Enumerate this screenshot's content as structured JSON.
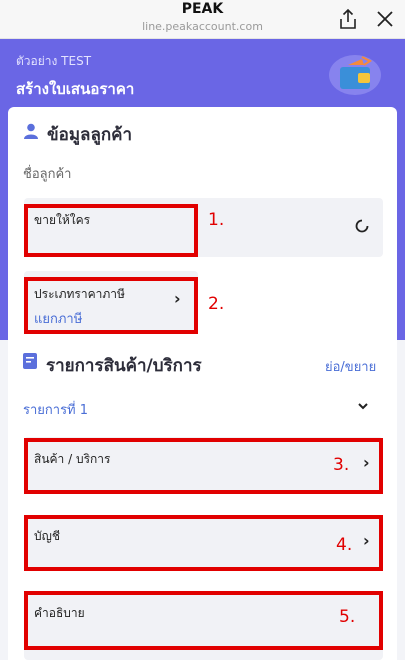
{
  "window": {
    "title": "PEAK",
    "url": "line.peakaccount.com"
  },
  "header": {
    "company": "ตัวอย่าง TEST",
    "title": "สร้างใบเสนอราคา"
  },
  "customer": {
    "section_title": "ข้อมูลลูกค้า",
    "name_label": "ชื่อลูกค้า",
    "sell_to_label": "ขายให้ใคร",
    "price_type_label": "ประเภทราคาภาษี",
    "price_type_value": "แยกภาษี"
  },
  "items": {
    "section_title": "รายการสินค้า/บริการ",
    "collapse_link": "ย่อ/ขยาย",
    "item_label": "รายการที่ 1",
    "product_label": "สินค้า / บริการ",
    "account_label": "บัญชี",
    "description_label": "คำอธิบาย"
  },
  "annotations": [
    "1.",
    "2.",
    "3.",
    "4.",
    "5."
  ],
  "colors": {
    "header": "#6a66e5",
    "annotation": "#e10000",
    "link": "#4a6ed6"
  }
}
